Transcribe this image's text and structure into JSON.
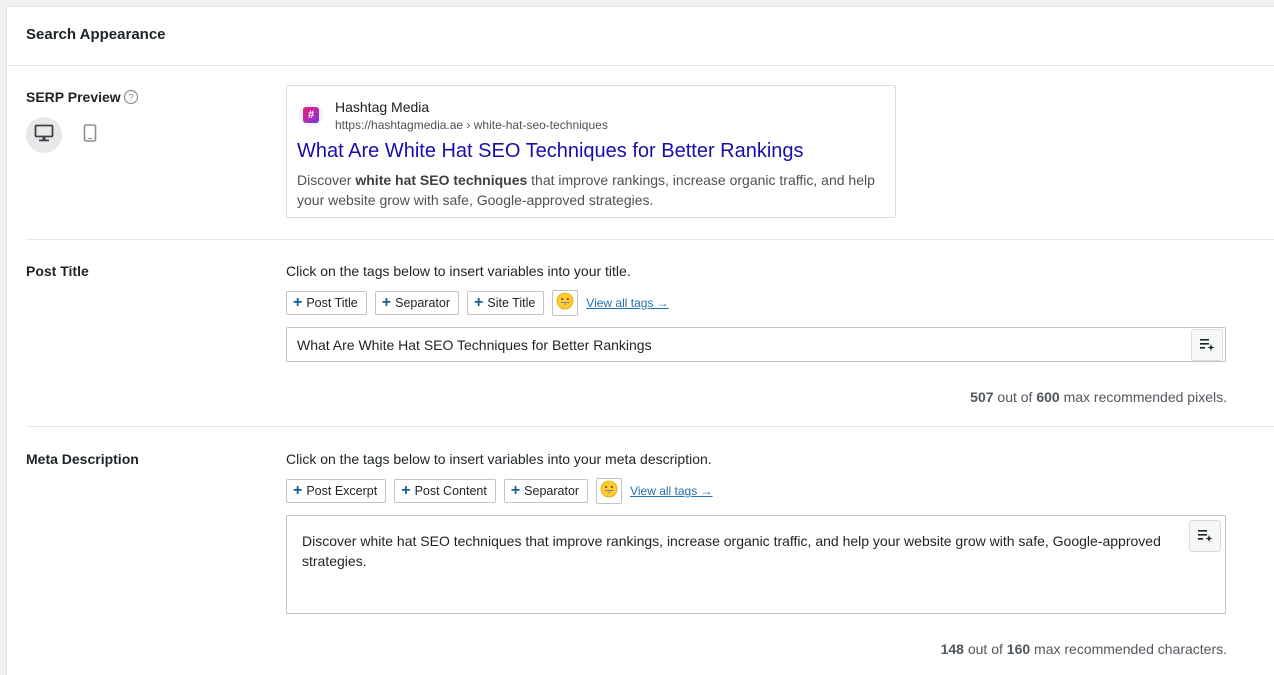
{
  "panel": {
    "title": "Search Appearance"
  },
  "serp_preview": {
    "label": "SERP Preview",
    "icons": {
      "help": "question-circle-icon",
      "desktop": "desktop-icon",
      "mobile": "mobile-icon",
      "favicon": "hashtag-logo"
    },
    "active_device": "desktop",
    "favicon_text": "#",
    "site_name": "Hashtag Media",
    "url": "https://hashtagmedia.ae › white-hat-seo-techniques",
    "title": "What Are White Hat SEO Techniques for Better Rankings",
    "description": {
      "before": "Discover ",
      "bold": "white hat SEO techniques",
      "after": " that improve rankings, increase organic traffic, and help your website grow with safe, Google-approved strategies."
    },
    "colors": {
      "title": "#1a0dab",
      "text": "#4d5156"
    }
  },
  "post_title": {
    "label": "Post Title",
    "hint": "Click on the tags below to insert variables into your title.",
    "tags": [
      "Post Title",
      "Separator",
      "Site Title"
    ],
    "view_all": "View all tags →",
    "value": "What Are White Hat SEO Techniques for Better Rankings",
    "counter": {
      "current": "507",
      "mid": " out of ",
      "max": "600",
      "suffix": " max recommended pixels."
    }
  },
  "meta_description": {
    "label": "Meta Description",
    "hint": "Click on the tags below to insert variables into your meta description.",
    "tags": [
      "Post Excerpt",
      "Post Content",
      "Separator"
    ],
    "view_all": "View all tags →",
    "value": "Discover white hat SEO techniques that improve rankings, increase organic traffic, and help your website grow with safe, Google-approved strategies.",
    "counter": {
      "current": "148",
      "mid": " out of ",
      "max": "160",
      "suffix": " max recommended characters."
    }
  },
  "colors": {
    "accent": "#2271b1",
    "tag_plus": "#135e96",
    "link": "#2271b1"
  }
}
